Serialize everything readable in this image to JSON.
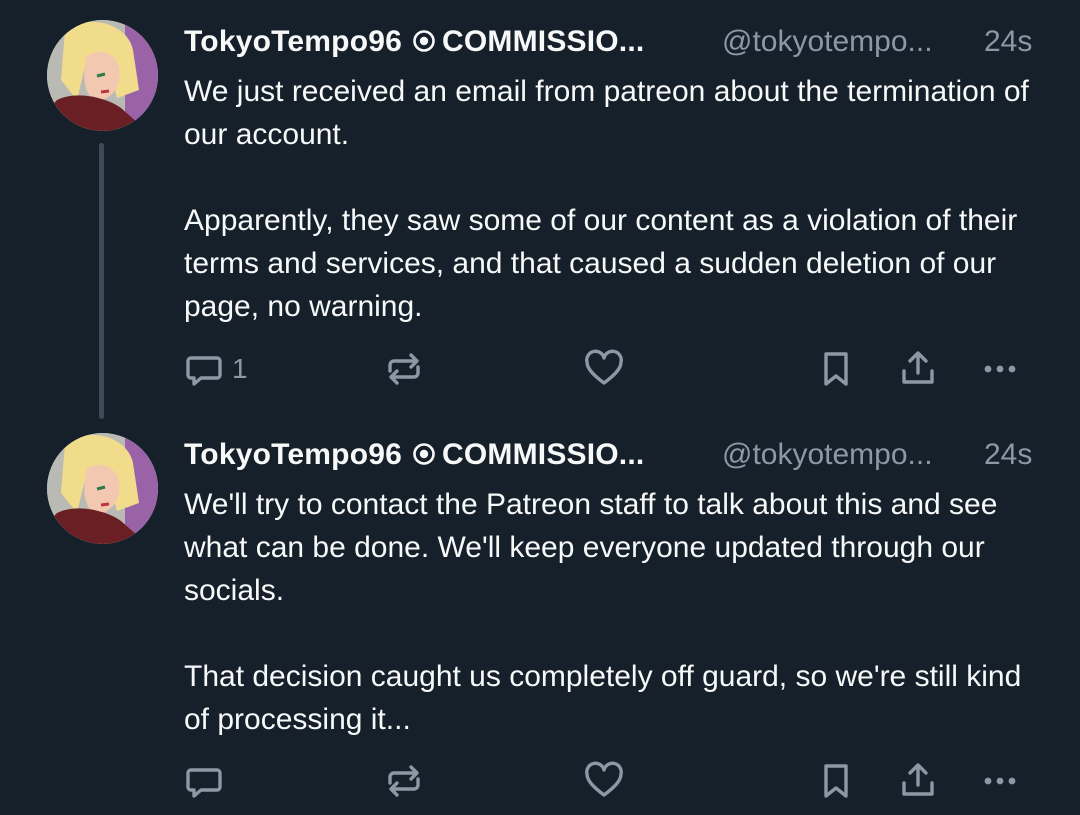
{
  "posts": [
    {
      "author": {
        "display_name": "TokyoTempo96",
        "badge": "COMMISSIO...",
        "handle": "@tokyotempo...",
        "avatar": "avatar-icon"
      },
      "time": "24s",
      "paragraphs": [
        "We just received an email from patreon about the termination of our account.",
        "Apparently, they saw some of our content as a violation of their terms and services, and that caused a sudden deletion of our page, no warning."
      ],
      "actions": {
        "reply_count": "1"
      }
    },
    {
      "author": {
        "display_name": "TokyoTempo96",
        "badge": "COMMISSIO...",
        "handle": "@tokyotempo...",
        "avatar": "avatar-icon"
      },
      "time": "24s",
      "paragraphs": [
        "We'll try to contact the Patreon staff to talk about this and see what can be done. We'll keep everyone updated through our socials.",
        "That decision caught us completely off guard, so we're still kind of processing it..."
      ],
      "actions": {
        "reply_count": ""
      }
    }
  ],
  "colors": {
    "background": "#15202b",
    "text": "#f7f9f9",
    "muted": "#8b98a5",
    "thread_line": "#3e4a56"
  }
}
